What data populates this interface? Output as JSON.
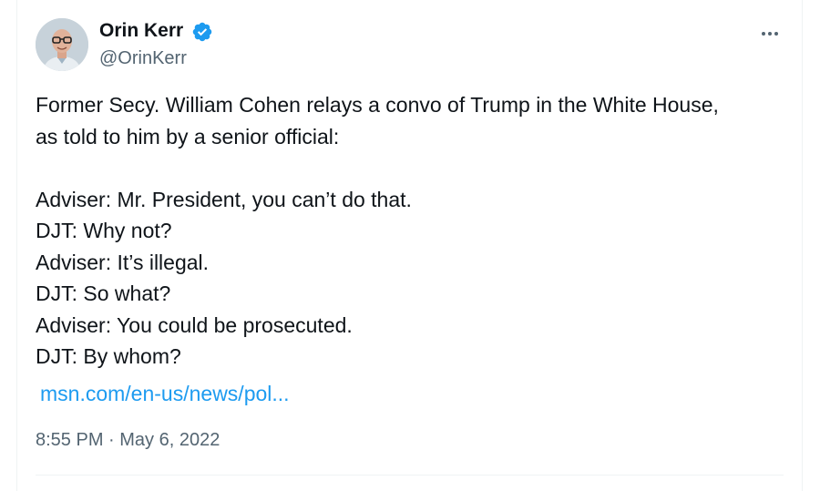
{
  "author": {
    "name": "Orin Kerr",
    "handle": "@OrinKerr"
  },
  "tweet": {
    "lines": [
      "Former Secy. William Cohen relays a convo of Trump in the White House,",
      "as told to him by a senior official:",
      "Adviser: Mr. President, you can’t do that.",
      "DJT: Why not?",
      "Adviser: It’s illegal.",
      "DJT: So what?",
      "Adviser: You could be prosecuted.",
      "DJT: By whom?"
    ],
    "link_text": "msn.com/en-us/news/pol...",
    "timestamp": "8:55 PM · May 6, 2022"
  },
  "colors": {
    "text": "#0f1419",
    "secondary": "#536471",
    "link": "#1d9bf0",
    "verified": "#1d9bf0"
  },
  "icons": {
    "verified": "verified-badge-icon",
    "more": "more-options-icon"
  }
}
